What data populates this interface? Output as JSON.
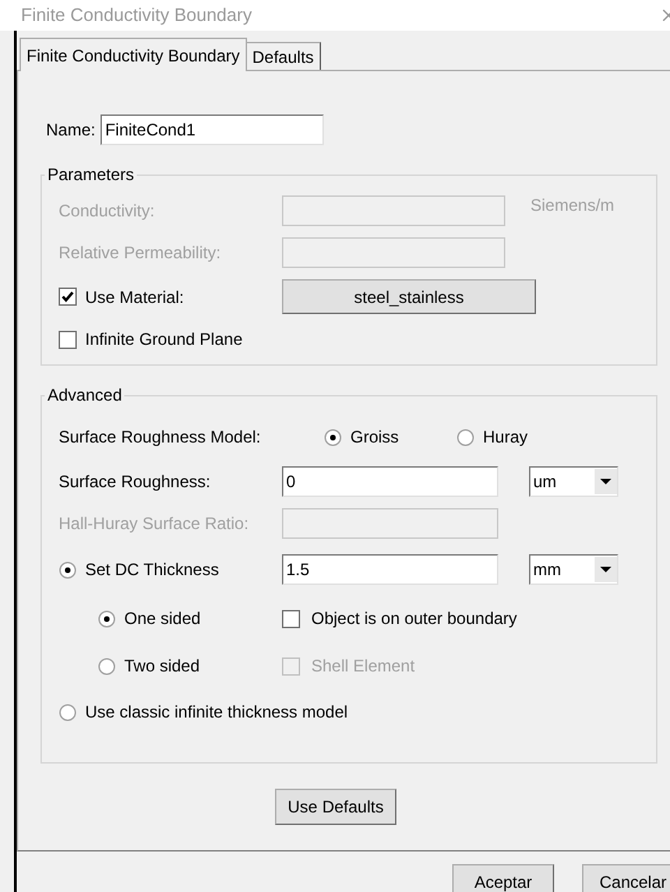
{
  "window": {
    "title": "Finite Conductivity Boundary"
  },
  "tabs": [
    {
      "label": "Finite Conductivity Boundary",
      "selected": true
    },
    {
      "label": "Defaults",
      "selected": false
    }
  ],
  "name_field": {
    "label": "Name:",
    "value": "FiniteCond1"
  },
  "parameters": {
    "title": "Parameters",
    "rows": [
      {
        "kind": "field",
        "label": "Conductivity:",
        "disabled": true,
        "unit": "Siemens/m"
      },
      {
        "kind": "field",
        "label": "Relative Permeability:",
        "disabled": true
      },
      {
        "kind": "check_button",
        "label": "Use Material:",
        "checked": true,
        "button": "steel_stainless"
      },
      {
        "kind": "check",
        "label": "Infinite Ground Plane",
        "checked": false
      }
    ]
  },
  "advanced": {
    "title": "Advanced",
    "rows": [
      {
        "kind": "radio_group",
        "label": "Surface Roughness Model:",
        "options": [
          {
            "label": "Groiss",
            "selected": true
          },
          {
            "label": "Huray",
            "selected": false
          }
        ]
      },
      {
        "kind": "field",
        "label": "Surface Roughness:",
        "disabled": false,
        "value": "0",
        "unit_select": "um"
      },
      {
        "kind": "field",
        "label": "Hall-Huray Surface Ratio:",
        "disabled": true
      },
      {
        "kind": "radio_field",
        "label": "Set DC Thickness",
        "selected": true,
        "value": "1.5",
        "unit_select": "mm"
      },
      {
        "kind": "sub",
        "radio": {
          "label": "One sided",
          "selected": true
        },
        "check": {
          "label": "Object is on outer boundary",
          "checked": false,
          "disabled": false
        }
      },
      {
        "kind": "sub",
        "radio": {
          "label": "Two sided",
          "selected": false
        },
        "check": {
          "label": "Shell Element",
          "checked": false,
          "disabled": true
        }
      },
      {
        "kind": "radio",
        "label": "Use classic infinite thickness model",
        "selected": false
      }
    ]
  },
  "use_defaults_button": "Use Defaults",
  "footer_buttons": [
    "Aceptar",
    "Cancelar"
  ]
}
